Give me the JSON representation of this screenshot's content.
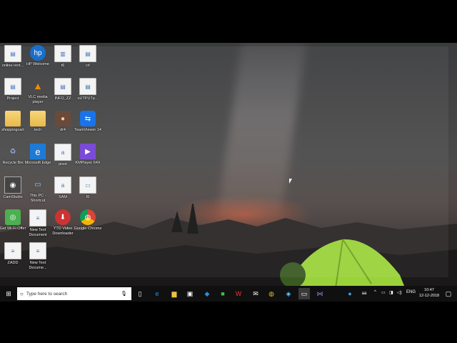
{
  "desktop": {
    "icons": [
      {
        "label": "online-rent...",
        "glyph": "▤"
      },
      {
        "label": "HP Welcome",
        "glyph": "hp"
      },
      {
        "label": "t6",
        "glyph": "▥"
      },
      {
        "label": "c#",
        "glyph": "▤"
      },
      {
        "label": "Project",
        "glyph": "▤"
      },
      {
        "label": "VLC media player",
        "glyph": "▲"
      },
      {
        "label": "INFO_ZZ",
        "glyph": "▤"
      },
      {
        "label": "oUTPUTp...",
        "glyph": "▤"
      },
      {
        "label": "shoppingcart",
        "glyph": ""
      },
      {
        "label": "tech",
        "glyph": ""
      },
      {
        "label": "dr4",
        "glyph": "●"
      },
      {
        "label": "TeamViewer 14",
        "glyph": "⇆"
      },
      {
        "label": "Recycle Bin",
        "glyph": "♻"
      },
      {
        "label": "Microsoft Edge",
        "glyph": "e"
      },
      {
        "label": "pivot",
        "glyph": "a"
      },
      {
        "label": "KMPlayer 64X",
        "glyph": "▶"
      },
      {
        "label": "CamStudio",
        "glyph": "◉"
      },
      {
        "label": "This PC - Shortcut",
        "glyph": "▭"
      },
      {
        "label": "SAM",
        "glyph": "a"
      },
      {
        "label": "t5",
        "glyph": "▭"
      },
      {
        "label": "Get Wi-Fi Offer",
        "glyph": "◎"
      },
      {
        "label": "New Text Document",
        "glyph": "≡"
      },
      {
        "label": "YTD Video Downloader",
        "glyph": "⬇"
      },
      {
        "label": "Google Chrome",
        "glyph": "◍"
      },
      {
        "label": "ZADD",
        "glyph": "≡"
      },
      {
        "label": "New Text Docume...",
        "glyph": "≡"
      }
    ]
  },
  "taskbar": {
    "search_placeholder": "Type here to search",
    "tray": {
      "language": "ENG",
      "time": "10:47",
      "date": "12-12-2018"
    }
  },
  "colors": {
    "taskbar": "#101010",
    "accent": "#0078d7"
  }
}
